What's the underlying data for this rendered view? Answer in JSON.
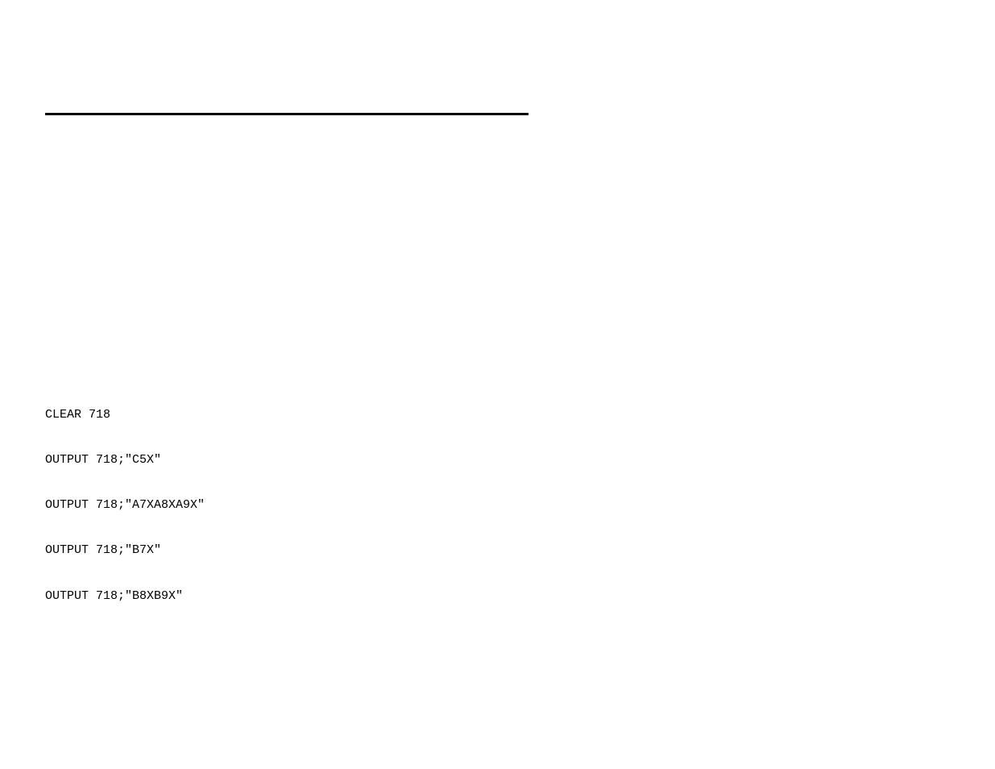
{
  "code": {
    "lines": [
      "CLEAR 718",
      "OUTPUT 718;\"C5X\"",
      "OUTPUT 718;\"A7XA8XA9X\"",
      "OUTPUT 718;\"B7X\"",
      "OUTPUT 718;\"B8XB9X\""
    ]
  }
}
